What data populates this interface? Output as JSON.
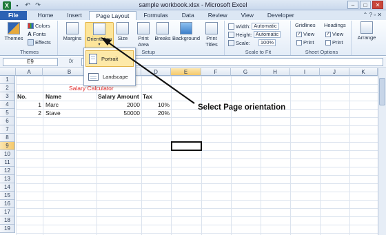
{
  "window": {
    "title": "sample workbook.xlsx - Microsoft Excel",
    "qat": [
      "save-icon",
      "undo-icon",
      "redo-icon"
    ]
  },
  "tabs": [
    "File",
    "Home",
    "Insert",
    "Page Layout",
    "Formulas",
    "Data",
    "Review",
    "View",
    "Developer"
  ],
  "active_tab": "Page Layout",
  "ribbon": {
    "themes": {
      "themes": "Themes",
      "colors": "Colors",
      "fonts": "Fonts",
      "effects": "Effects",
      "group": "Themes"
    },
    "page_setup": {
      "margins": "Margins",
      "orientation": "Orientation",
      "size": "Size",
      "print_area": "Print Area",
      "breaks": "Breaks",
      "background": "Background",
      "print_titles": "Print Titles",
      "group": "Setup"
    },
    "scale": {
      "width_label": "Width:",
      "width_value": "Automatic",
      "height_label": "Height:",
      "height_value": "Automatic",
      "scale_label": "Scale:",
      "scale_value": "100%",
      "group": "Scale to Fit"
    },
    "sheet_options": {
      "gridlines": "Gridlines",
      "headings": "Headings",
      "view": "View",
      "print": "Print",
      "group": "Sheet Options"
    },
    "arrange": "Arrange"
  },
  "formula_bar": {
    "name_box": "E9",
    "fx": "fx"
  },
  "orientation_menu": {
    "items": [
      "Portrait",
      "Landscape"
    ]
  },
  "sheet": {
    "columns": [
      "A",
      "B",
      "C",
      "D",
      "E",
      "F",
      "G",
      "H",
      "I",
      "J",
      "K"
    ],
    "rows": [
      "1",
      "2",
      "3",
      "4",
      "5",
      "6",
      "7",
      "8",
      "9",
      "10",
      "11",
      "12",
      "13",
      "14",
      "15",
      "16",
      "17",
      "18",
      "19"
    ],
    "selected_cell": "E9",
    "title": "Salary Calculator",
    "headers": {
      "no": "No.",
      "name": "Name",
      "salary": "Salary Amount",
      "tax": "Tax"
    },
    "data": [
      {
        "no": "1",
        "name": "Marc",
        "salary": "2000",
        "tax": "10%"
      },
      {
        "no": "2",
        "name": "Stave",
        "salary": "50000",
        "tax": "20%"
      }
    ]
  },
  "annotation": "Select Page orientation"
}
